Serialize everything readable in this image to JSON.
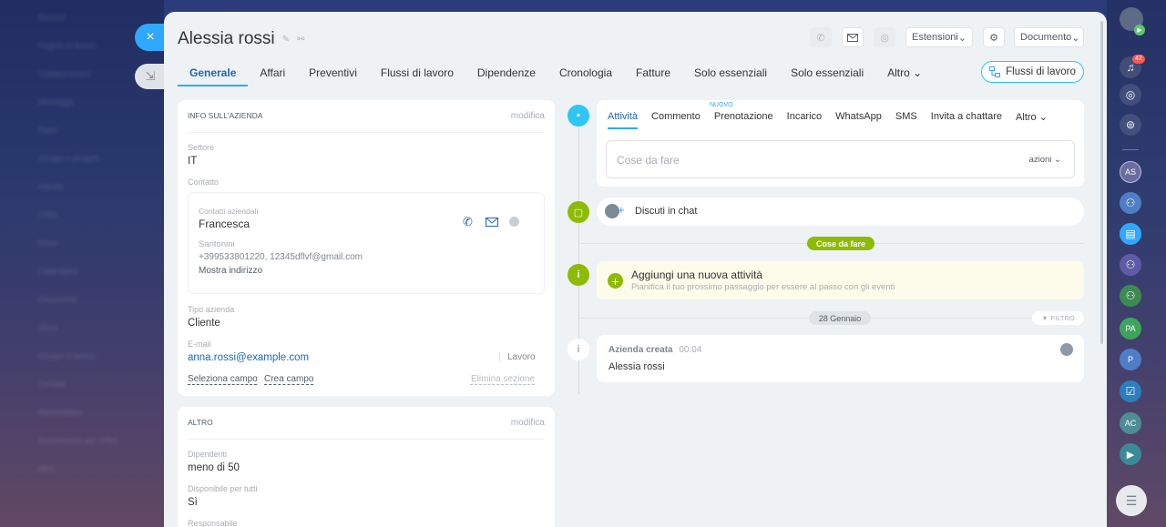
{
  "window": {
    "close_glyph": "×",
    "minimize_glyph": "⇲"
  },
  "page_title": "Alessia rossi",
  "header": {
    "estensioni": "Estensioni",
    "documento": "Documento"
  },
  "tabs": [
    "Generale",
    "Affari",
    "Preventivi",
    "Flussi di lavoro",
    "Dipendenze",
    "Cronologia",
    "Fatture",
    "Solo essenziali",
    "Solo essenziali",
    "Altro"
  ],
  "flussi_button": "Flussi di lavoro",
  "company_info": {
    "heading": "INFO SULL'AZIENDA",
    "edit": "modifica",
    "settore_label": "Settore",
    "settore_value": "IT",
    "contatto_label": "Contatto",
    "contact_type": "Contatti aziendali",
    "contact_name": "Francesca",
    "contact_surname": "Santonini",
    "contact_details": "+399533801220, 12345dflvf@gmail.com",
    "show_address": "Mostra indirizzo",
    "tipo_label": "Tipo azienda",
    "tipo_value": "Cliente",
    "email_label": "E-mail",
    "email_value": "anna.rossi@example.com",
    "email_type": "Lavoro",
    "select_field": "Seleziona campo",
    "create_field": "Crea campo",
    "delete_section": "Elimina sezione"
  },
  "other_section": {
    "heading": "ALTRO",
    "edit": "modifica",
    "dipendenti_label": "Dipendenti",
    "dipendenti_value": "meno di 50",
    "disponibile_label": "Disponibile per tutti",
    "disponibile_value": "Sì",
    "responsabile_label": "Responsabile"
  },
  "activity_tabs": {
    "new_badge": "NUOVO",
    "items": [
      "Attività",
      "Commento",
      "Prenotazione",
      "Incarico",
      "WhatsApp",
      "SMS",
      "Invita a chattare",
      "Altro"
    ]
  },
  "todo_input_placeholder": "Cose da fare",
  "todo_actions": "azioni",
  "chat_label": "Discuti in chat",
  "todo_badge": "Cose da fare",
  "new_activity": {
    "title": "Aggiungi una nuova attività",
    "subtitle": "Pianifica il tuo prossimo passaggio per essere al passo con gli eventi"
  },
  "date_badge": "28 Gennaio",
  "filter_label": "FILTRO",
  "event": {
    "title": "Azienda creata",
    "time": "00:04",
    "name": "Alessia rossi"
  },
  "sidebar": {
    "notif_count": "42",
    "avatars": [
      "AS",
      "PA",
      "P",
      "AC"
    ]
  },
  "bg_menu": [
    "Bitrix24",
    "Pagina di flusso",
    "Collaborazioni",
    "Messaggi",
    "Feed",
    "Gruppi e progetti",
    "Attività",
    "CRM",
    "Drive",
    "Calendario",
    "Documenti",
    "Store",
    "Gruppi di lavoro",
    "Contatti",
    "Marketplace",
    "Ecommerce per CRM",
    "Altro"
  ],
  "colors": {
    "accent": "#2fa8ff",
    "green": "#8dbb00",
    "link": "#2067b0"
  }
}
